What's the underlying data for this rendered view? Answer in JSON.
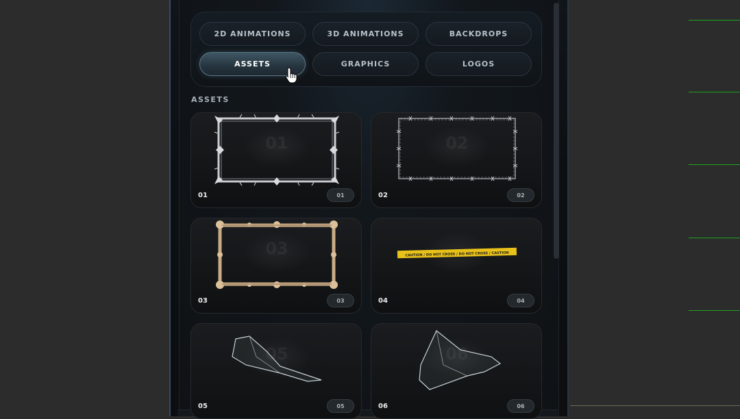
{
  "tabs": [
    {
      "label": "2D ANIMATIONS",
      "active": false
    },
    {
      "label": "3D ANIMATIONS",
      "active": false
    },
    {
      "label": "BACKDROPS",
      "active": false
    },
    {
      "label": "ASSETS",
      "active": true
    },
    {
      "label": "GRAPHICS",
      "active": false
    },
    {
      "label": "LOGOS",
      "active": false
    }
  ],
  "section": {
    "title": "ASSETS"
  },
  "assets": [
    {
      "label": "01",
      "badge": "01",
      "art": "silver-thorn-frame-icon"
    },
    {
      "label": "02",
      "badge": "02",
      "art": "barbed-wire-frame-icon"
    },
    {
      "label": "03",
      "badge": "03",
      "art": "bone-frame-icon"
    },
    {
      "label": "04",
      "badge": "04",
      "art": "caution-tape-icon",
      "tape_text": "CAUTION / DO NOT CROSS / DO NOT CROSS / CAUTION"
    },
    {
      "label": "05",
      "badge": "05",
      "art": "glass-shard-icon"
    },
    {
      "label": "06",
      "badge": "06",
      "art": "glass-shard-icon"
    }
  ],
  "colors": {
    "accent": "#3e5664",
    "tab_text": "#b7c0c8",
    "active_tab_text": "#ffffff",
    "caution_yellow": "#e8c21a",
    "green_guides": "#1fa21f"
  }
}
